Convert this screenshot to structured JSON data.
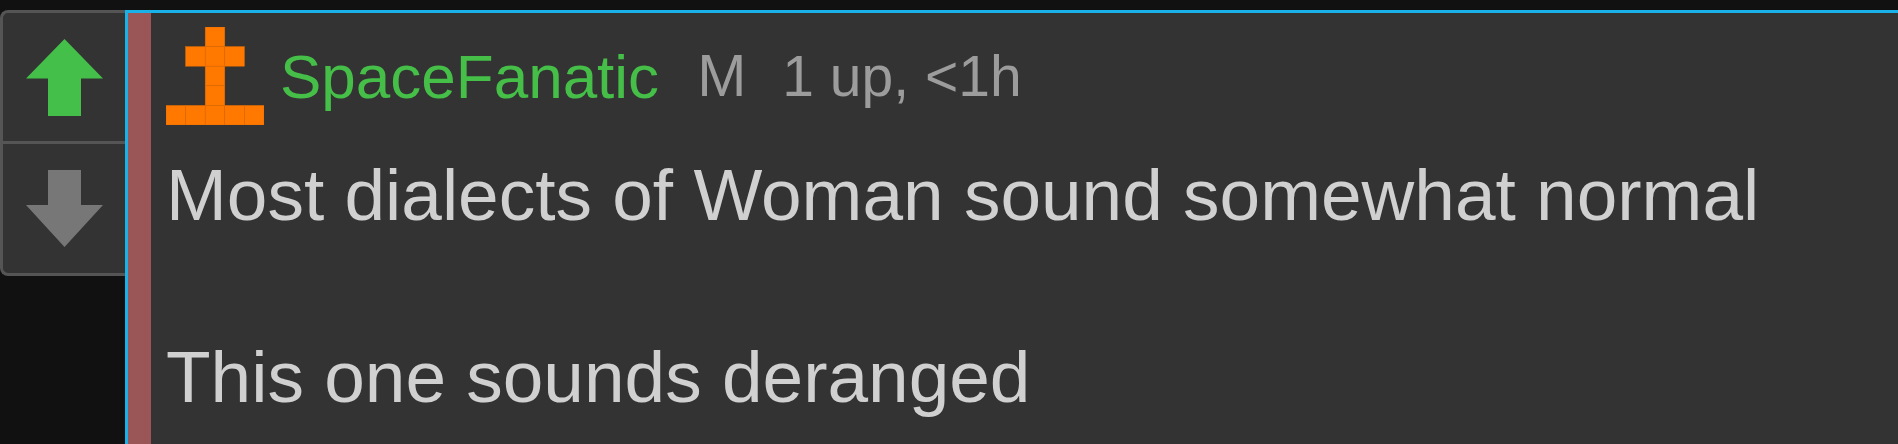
{
  "votes": [
    {
      "kind": "up",
      "selected": true
    },
    {
      "kind": "down",
      "selected": false
    }
  ],
  "comment": {
    "author": "SpaceFanatic",
    "badge": "M",
    "meta": "1 up, <1h",
    "paragraphs": [
      "Most dialects of Woman sound somewhat normal",
      "This one sounds deranged"
    ]
  }
}
